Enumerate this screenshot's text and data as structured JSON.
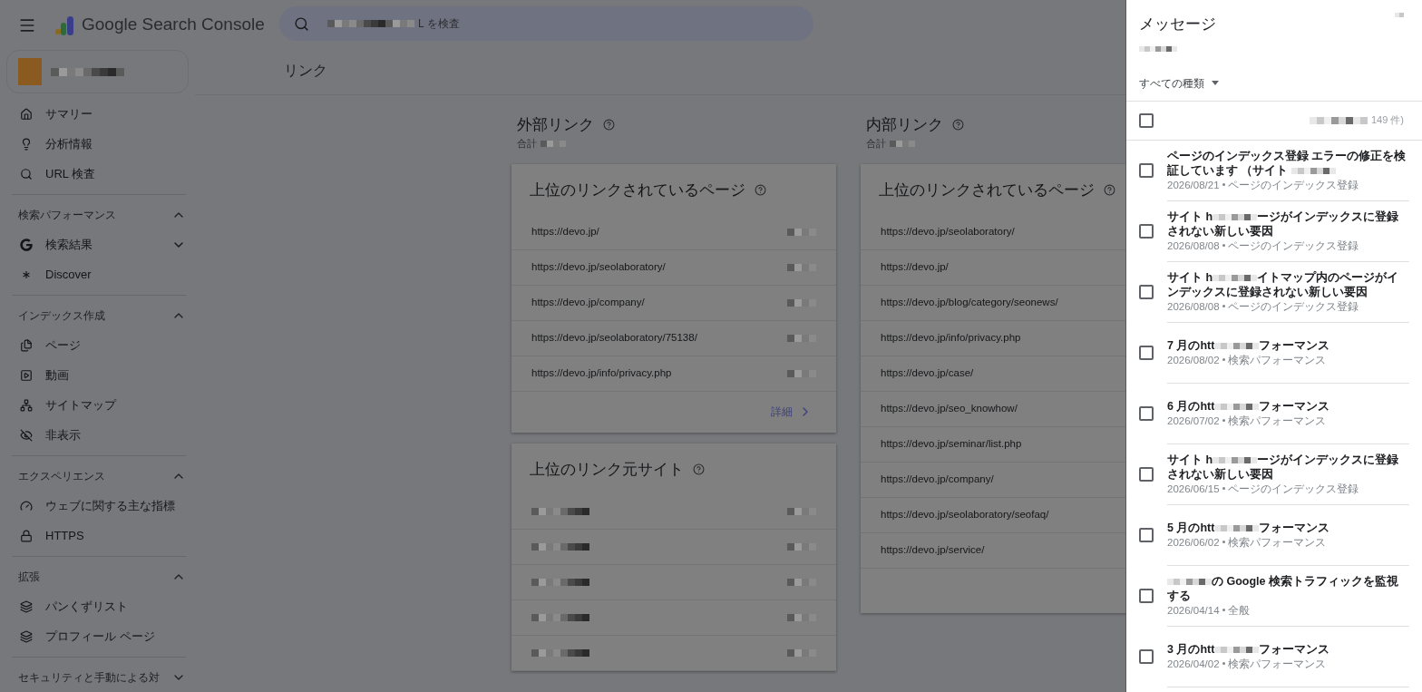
{
  "app": {
    "title": "Google Search Console"
  },
  "search": {
    "placeholder_end": "L を検査"
  },
  "page_title": "リンク",
  "sidebar": {
    "items": [
      {
        "kind": "item",
        "label": "サマリー"
      },
      {
        "kind": "item",
        "label": "分析情報"
      },
      {
        "kind": "item",
        "label": "URL 検査"
      },
      {
        "kind": "section",
        "label": "検索パフォーマンス",
        "expanded": true,
        "children": [
          {
            "kind": "item",
            "label": "検索結果",
            "expanded": false
          },
          {
            "kind": "item",
            "label": "Discover"
          }
        ]
      },
      {
        "kind": "section",
        "label": "インデックス作成",
        "expanded": true,
        "children": [
          {
            "kind": "item",
            "label": "ページ"
          },
          {
            "kind": "item",
            "label": "動画"
          },
          {
            "kind": "item",
            "label": "サイトマップ"
          },
          {
            "kind": "item",
            "label": "非表示"
          }
        ]
      },
      {
        "kind": "section",
        "label": "エクスペリエンス",
        "expanded": true,
        "children": [
          {
            "kind": "item",
            "label": "ウェブに関する主な指標"
          },
          {
            "kind": "item",
            "label": "HTTPS"
          }
        ]
      },
      {
        "kind": "section",
        "label": "拡張",
        "expanded": true,
        "children": [
          {
            "kind": "item",
            "label": "パンくずリスト"
          },
          {
            "kind": "item",
            "label": "プロフィール ページ"
          }
        ]
      },
      {
        "kind": "section",
        "label": "セキュリティと手動による対",
        "expanded": false
      }
    ]
  },
  "external": {
    "heading": "外部リンク",
    "total_label": "合計",
    "cards": [
      {
        "title": "上位のリンクされているページ",
        "rows": [
          "https://devo.jp/",
          "https://devo.jp/seolaboratory/",
          "https://devo.jp/company/",
          "https://devo.jp/seolaboratory/75138/",
          "https://devo.jp/info/privacy.php"
        ],
        "more": "詳細"
      },
      {
        "title": "上位のリンク元サイト",
        "rows": [
          "",
          "",
          "",
          "",
          ""
        ]
      }
    ]
  },
  "internal": {
    "heading": "内部リンク",
    "total_label": "合計",
    "cards": [
      {
        "title": "上位のリンクされているページ",
        "rows": [
          "https://devo.jp/seolaboratory/",
          "https://devo.jp/",
          "https://devo.jp/blog/category/seonews/",
          "https://devo.jp/info/privacy.php",
          "https://devo.jp/case/",
          "https://devo.jp/seo_knowhow/",
          "https://devo.jp/seminar/list.php",
          "https://devo.jp/company/",
          "https://devo.jp/seolaboratory/seofaq/",
          "https://devo.jp/service/"
        ]
      }
    ]
  },
  "messages": {
    "title": "メッセージ",
    "filter": "すべての種類",
    "select_all_checked": false,
    "count_end": "149 件)",
    "items": [
      {
        "title_start": "ページのインデックス登録 エラーの修正を検証しています （サイト ",
        "date": "2026/08/21",
        "category": "ページのインデックス登録",
        "checked": false
      },
      {
        "title_start": "サイト h",
        "title_end": "ージがインデックスに登録されない新しい要因",
        "date": "2026/08/08",
        "category": "ページのインデックス登録",
        "checked": false
      },
      {
        "title_start": "サイト h",
        "title_end": "イトマップ内のページがインデックスに登録されない新しい要因",
        "date": "2026/08/08",
        "category": "ページのインデックス登録",
        "checked": false
      },
      {
        "title_start": "7 月のhtt",
        "title_end": "フォーマンス",
        "date": "2026/08/02",
        "category": "検索パフォーマンス",
        "checked": false
      },
      {
        "title_start": "6 月のhtt",
        "title_end": "フォーマンス",
        "date": "2026/07/02",
        "category": "検索パフォーマンス",
        "checked": false
      },
      {
        "title_start": "サイト h",
        "title_end": "ージがインデックスに登録されない新しい要因",
        "date": "2026/06/15",
        "category": "ページのインデックス登録",
        "checked": false
      },
      {
        "title_start": "5 月のhtt",
        "title_end": "フォーマンス",
        "date": "2026/06/02",
        "category": "検索パフォーマンス",
        "checked": false
      },
      {
        "title_end": "の Google 検索トラフィックを監視する",
        "date": "2026/04/14",
        "category": "全般",
        "checked": false
      },
      {
        "title_start": "3 月のhtt",
        "title_end": "フォーマンス",
        "date": "2026/04/02",
        "category": "検索パフォーマンス",
        "checked": false
      }
    ]
  }
}
